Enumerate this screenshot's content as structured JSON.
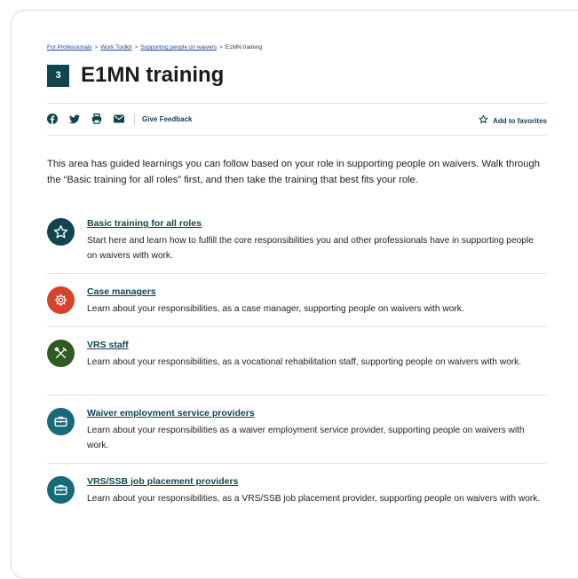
{
  "breadcrumb": {
    "items": [
      "For Professionals",
      "Work Toolkit",
      "Supporting people on waivers"
    ],
    "separator": ">",
    "current": "E1MN training"
  },
  "page": {
    "badge": "3",
    "title": "E1MN training"
  },
  "toolbar": {
    "icons": [
      "facebook-icon",
      "twitter-icon",
      "print-icon",
      "email-icon"
    ],
    "feedback": "Give Feedback",
    "favorites": "Add to favorites"
  },
  "intro": "This area has guided learnings you can follow based on your role in supporting people on waivers. Walk through the “Basic training for all roles” first, and then take the training that best fits your role.",
  "items": [
    {
      "title": "Basic training for all roles",
      "description": "Start here and learn how to fulfill the core responsibilities you and other professionals have in supporting people on waivers with work.",
      "icon": "star-icon",
      "color": "#10454f"
    },
    {
      "title": "Case managers",
      "description": "Learn about your responsibilities, as a case manager, supporting people on waivers with work.",
      "icon": "gear-icon",
      "color": "#d4432a"
    },
    {
      "title": "VRS staff",
      "description": "Learn about your responsibilities, as a vocational rehabilitation staff, supporting people on waivers with work.",
      "icon": "tools-icon",
      "color": "#2f5a24"
    },
    {
      "title": "Waiver employment service providers",
      "description": "Learn about your responsibilities as a waiver employment service provider, supporting people on waivers with work.",
      "icon": "briefcase-icon",
      "color": "#176a78"
    },
    {
      "title": "VRS/SSB job placement providers",
      "description": "Learn about your responsibilities, as a VRS/SSB job placement provider, supporting people on waivers with work.",
      "icon": "briefcase-icon",
      "color": "#176a78"
    }
  ]
}
